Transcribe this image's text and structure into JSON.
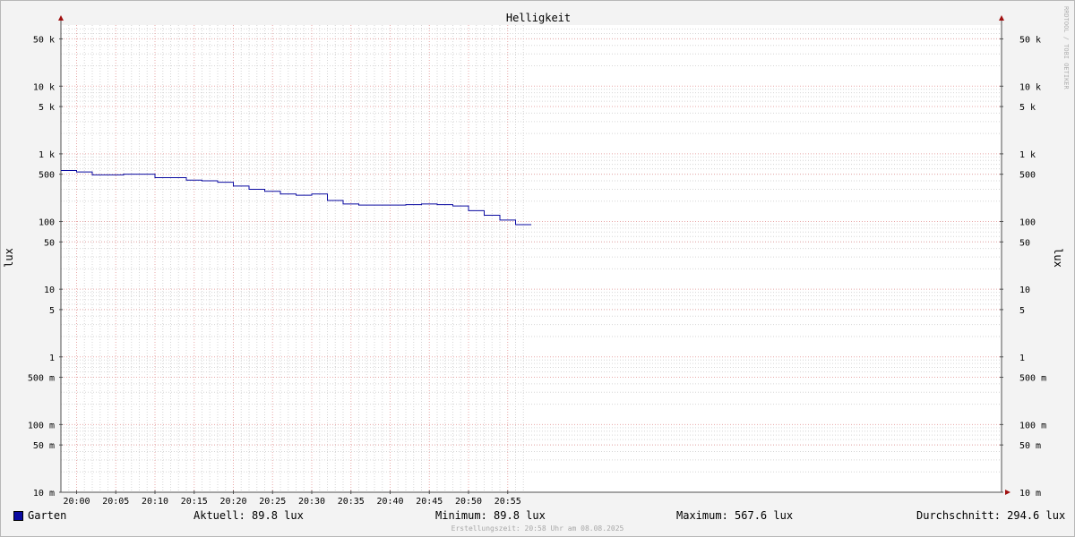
{
  "chart_data": {
    "type": "line",
    "title": "Helligkeit",
    "ylabel": "lux",
    "ylabel_right": "lux",
    "yscale": "log",
    "ylim": [
      0.01,
      80000
    ],
    "xlim": [
      "19:58",
      "21:58"
    ],
    "x_ticks": [
      "20:00",
      "20:05",
      "20:10",
      "20:15",
      "20:20",
      "20:25",
      "20:30",
      "20:35",
      "20:40",
      "20:45",
      "20:50",
      "20:55"
    ],
    "y_ticks": [
      {
        "value": 50000,
        "label": "50 k"
      },
      {
        "value": 10000,
        "label": "10 k"
      },
      {
        "value": 5000,
        "label": "5 k"
      },
      {
        "value": 1000,
        "label": "1 k"
      },
      {
        "value": 500,
        "label": "500"
      },
      {
        "value": 100,
        "label": "100"
      },
      {
        "value": 50,
        "label": "50"
      },
      {
        "value": 10,
        "label": "10"
      },
      {
        "value": 5,
        "label": "5"
      },
      {
        "value": 1,
        "label": "1"
      },
      {
        "value": 0.5,
        "label": "500 m"
      },
      {
        "value": 0.1,
        "label": "100 m"
      },
      {
        "value": 0.05,
        "label": "50 m"
      },
      {
        "value": 0.01,
        "label": "10 m"
      }
    ],
    "grid": true,
    "series": [
      {
        "name": "Garten",
        "color": "#0a0aa0",
        "points": [
          {
            "t": "19:58",
            "value": 567.6
          },
          {
            "t": "20:00",
            "value": 540
          },
          {
            "t": "20:02",
            "value": 490
          },
          {
            "t": "20:06",
            "value": 500
          },
          {
            "t": "20:10",
            "value": 445
          },
          {
            "t": "20:14",
            "value": 410
          },
          {
            "t": "20:16",
            "value": 400
          },
          {
            "t": "20:18",
            "value": 380
          },
          {
            "t": "20:20",
            "value": 335
          },
          {
            "t": "20:22",
            "value": 300
          },
          {
            "t": "20:24",
            "value": 280
          },
          {
            "t": "20:26",
            "value": 255
          },
          {
            "t": "20:28",
            "value": 245
          },
          {
            "t": "20:30",
            "value": 255
          },
          {
            "t": "20:32",
            "value": 205
          },
          {
            "t": "20:34",
            "value": 182
          },
          {
            "t": "20:36",
            "value": 175
          },
          {
            "t": "20:42",
            "value": 178
          },
          {
            "t": "20:44",
            "value": 182
          },
          {
            "t": "20:46",
            "value": 178
          },
          {
            "t": "20:48",
            "value": 170
          },
          {
            "t": "20:50",
            "value": 145
          },
          {
            "t": "20:52",
            "value": 124
          },
          {
            "t": "20:54",
            "value": 105
          },
          {
            "t": "20:56",
            "value": 89.8
          },
          {
            "t": "20:58",
            "value": 89.8
          }
        ]
      }
    ]
  },
  "legend": {
    "series_name": "Garten",
    "current": "Aktuell:  89.8 lux",
    "minimum": "Minimum:  89.8 lux",
    "maximum": "Maximum: 567.6 lux",
    "average": "Durchschnitt: 294.6 lux"
  },
  "footer": "Erstellungszeit: 20:58 Uhr am 08.08.2025",
  "watermark": "RRDTOOL / TOBI OETIKER",
  "colors": {
    "background": "#f3f3f3",
    "canvas": "#ffffff",
    "series": "#0a0aa0",
    "major_grid": "#e8a8a8",
    "minor_grid": "#d6d6d6",
    "axis": "#505050",
    "arrow": "#a01010"
  }
}
